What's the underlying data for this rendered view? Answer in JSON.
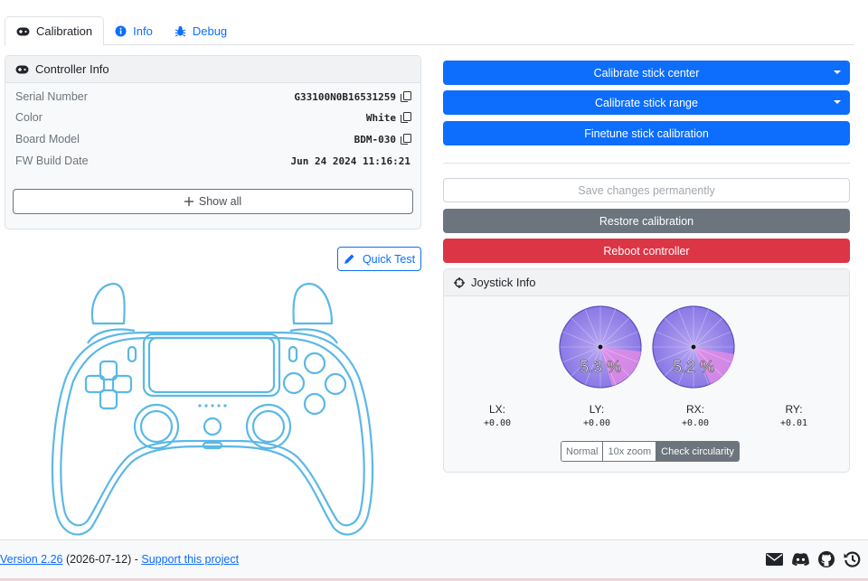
{
  "tabs": [
    {
      "label": "Calibration",
      "icon": "gamepad-icon",
      "active": true
    },
    {
      "label": "Info",
      "icon": "info-circle-icon",
      "active": false
    },
    {
      "label": "Debug",
      "icon": "bug-icon",
      "active": false
    }
  ],
  "controller_info": {
    "title": "Controller Info",
    "rows": [
      {
        "label": "Serial Number",
        "value": "G33100N0B16531259",
        "copyable": true
      },
      {
        "label": "Color",
        "value": "White",
        "copyable": true
      },
      {
        "label": "Board Model",
        "value": "BDM-030",
        "copyable": true
      },
      {
        "label": "FW Build Date",
        "value": "Jun 24 2024 11:16:21",
        "copyable": false
      }
    ],
    "show_all_label": "Show all"
  },
  "quick_test_label": "Quick Test",
  "actions": {
    "calibrate_center": "Calibrate stick center",
    "calibrate_range": "Calibrate stick range",
    "finetune": "Finetune stick calibration",
    "save": "Save changes permanently",
    "restore": "Restore calibration",
    "reboot": "Reboot controller"
  },
  "joystick_info": {
    "title": "Joystick Info",
    "left_circularity": "5.3 %",
    "right_circularity": "5.2 %",
    "axes": [
      {
        "label": "LX:",
        "value": "+0.00"
      },
      {
        "label": "LY:",
        "value": "+0.00"
      },
      {
        "label": "RX:",
        "value": "+0.00"
      },
      {
        "label": "RY:",
        "value": "+0.01"
      }
    ],
    "modes": [
      {
        "label": "Normal",
        "active": false
      },
      {
        "label": "10x zoom",
        "active": false
      },
      {
        "label": "Check circularity",
        "active": true
      }
    ]
  },
  "footer": {
    "version_link": "Version 2.26",
    "date": " (2026-07-12) - ",
    "support_link": "Support this project",
    "icons": [
      "envelope-icon",
      "discord-icon",
      "github-icon",
      "history-icon"
    ]
  },
  "colors": {
    "primary": "#0d6efd",
    "secondary": "#6c757d",
    "danger": "#dc3545",
    "controller_outline": "#5bb8e6"
  }
}
